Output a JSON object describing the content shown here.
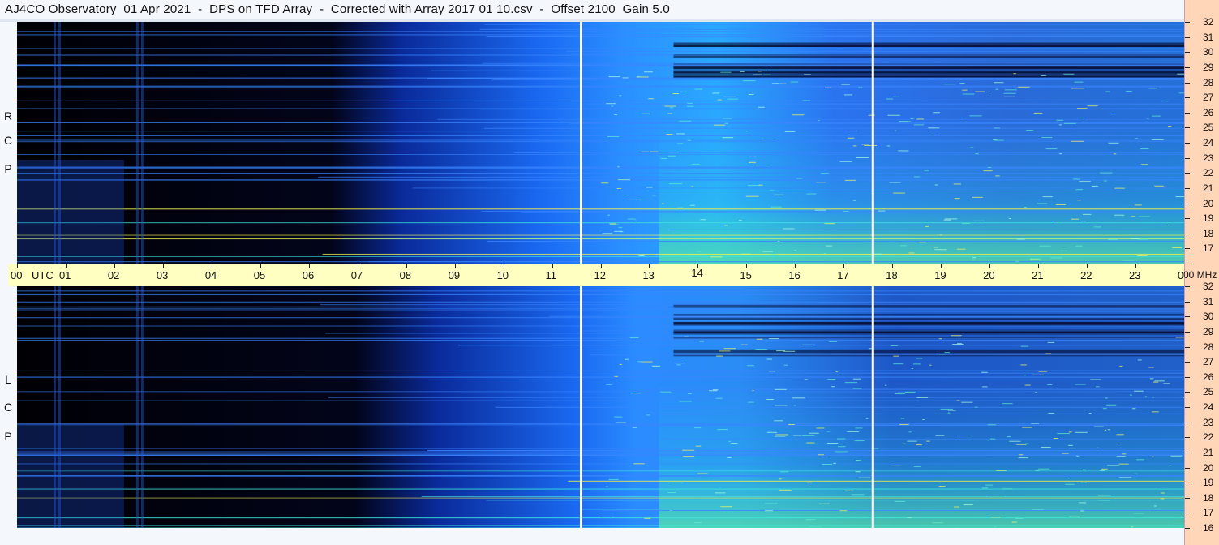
{
  "title": "AJ4CO Observatory  01 Apr 2021  -  DPS on TFD Array  -  Corrected with Array 2017 01 10.csv  -  Offset 2100  Gain 5.0",
  "chart_data": {
    "type": "heatmap",
    "panels": [
      {
        "name": "RCP",
        "label_letters": [
          "R",
          "C",
          "P"
        ]
      },
      {
        "name": "LCP",
        "label_letters": [
          "L",
          "C",
          "P"
        ]
      }
    ],
    "x": {
      "unit_label": "UTC",
      "range": [
        0,
        24
      ],
      "tick_labels": [
        "00",
        "01",
        "02",
        "03",
        "04",
        "05",
        "06",
        "07",
        "08",
        "09",
        "10",
        "11",
        "12",
        "13",
        "14",
        "15",
        "16",
        "17",
        "18",
        "19",
        "20",
        "21",
        "22",
        "23",
        "00"
      ]
    },
    "y": {
      "unit_label": "MHz",
      "range": [
        16,
        32
      ],
      "tick_labels": [
        "16",
        "17",
        "18",
        "19",
        "20",
        "21",
        "22",
        "23",
        "24",
        "25",
        "26",
        "27",
        "28",
        "29",
        "30",
        "31",
        "32"
      ]
    },
    "vertical_markers_utc": [
      11.6,
      17.6
    ],
    "colors": {
      "low": "#000000",
      "mid": "#1e6fff",
      "high": "#2de0e0",
      "peak": "#f0f050"
    }
  }
}
